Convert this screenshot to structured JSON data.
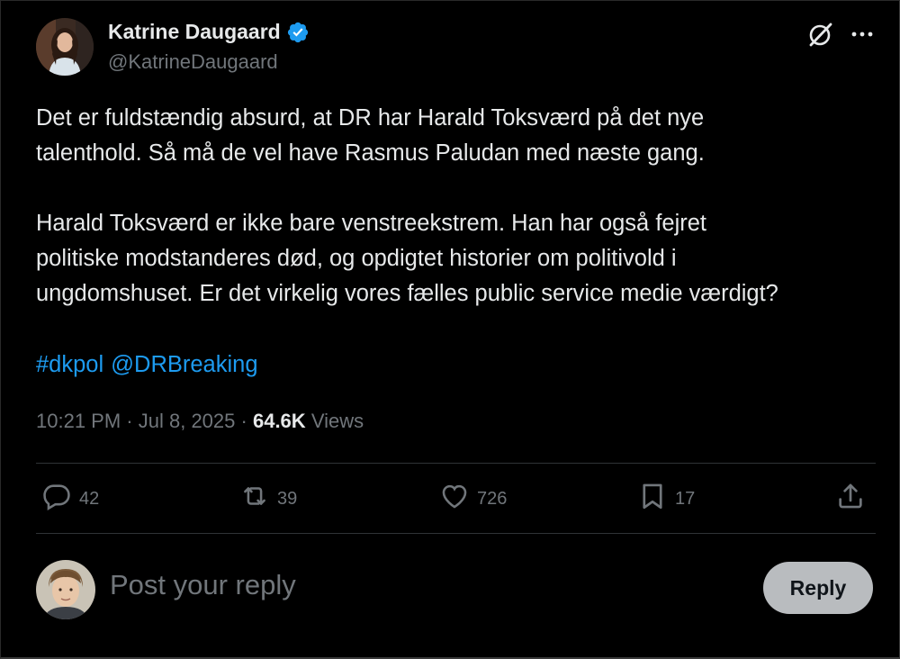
{
  "author": {
    "name": "Katrine Daugaard",
    "handle": "@KatrineDaugaard",
    "verified_color": "#1d9bf0"
  },
  "post": {
    "paragraph1": "Det er fuldstændig absurd, at DR har Harald Toksværd på det nye\ntalenthold. Så må de vel have Rasmus Paludan med næste gang.",
    "paragraph2": "Harald Toksværd er ikke bare venstreekstrem. Han har også fejret\npolitiske modstanderes død, og opdigtet historier om politivold i\nungdomshuset. Er det virkelig vores fælles public service medie værdigt?",
    "hashtag": "#dkpol",
    "mention": "@DRBreaking"
  },
  "meta": {
    "time": "10:21 PM",
    "date": "Jul 8, 2025",
    "separator": "·",
    "views_count": "64.6K",
    "views_label": "Views"
  },
  "actions": {
    "replies": "42",
    "reposts": "39",
    "likes": "726",
    "bookmarks": "17"
  },
  "icons": [
    "grok-icon",
    "more-icon",
    "reply-icon",
    "repost-icon",
    "like-icon",
    "bookmark-icon",
    "share-icon",
    "verified-badge-icon"
  ],
  "composer": {
    "placeholder": "Post your reply",
    "button_label": "Reply"
  },
  "colors": {
    "background": "#000000",
    "accent": "#1d9bf0",
    "muted": "#71767b",
    "text": "#e7e9ea",
    "reply_button": "#b9bcbf"
  }
}
